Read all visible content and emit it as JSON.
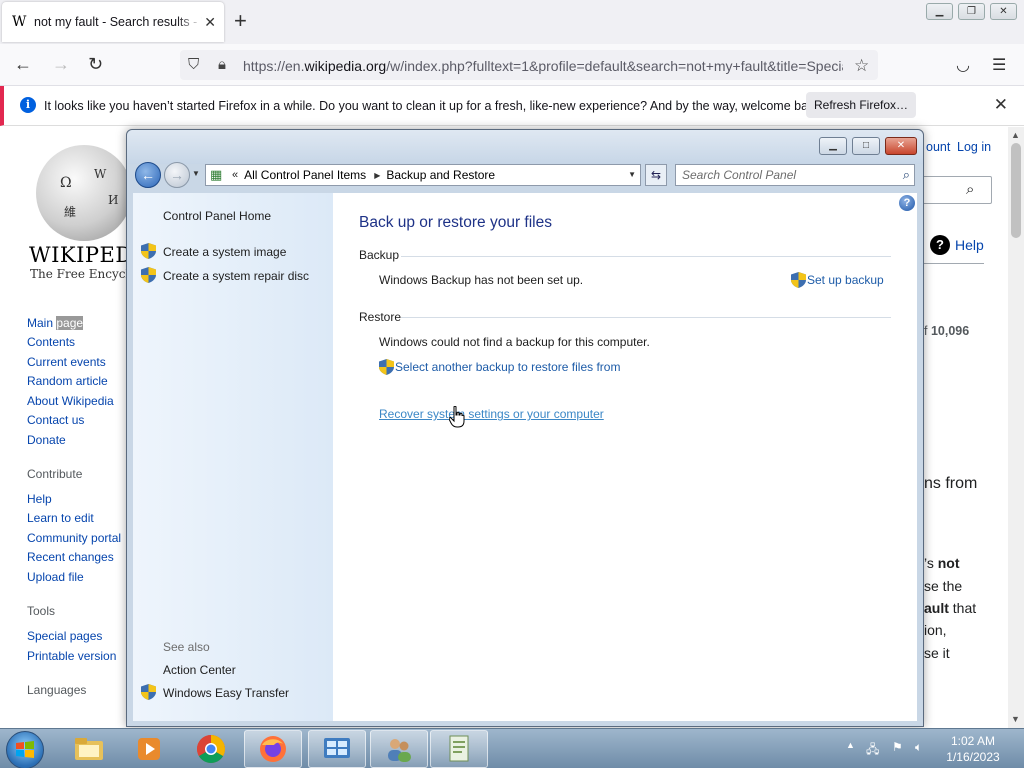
{
  "browser": {
    "tab_title": "not my fault - Search results - Wikipedia",
    "tab_favicon": "W",
    "new_tab": "+",
    "url_prefix": "https://en.",
    "url_domain": "wikipedia.org",
    "url_path": "/w/index.php?fulltext=1&profile=default&search=not+my+fault&title=Special:Search",
    "notice_text": "It looks like you haven’t started Firefox in a while. Do you want to clean it up for a fresh, like-new experience? And by the way, welcome back!",
    "notice_button": "Refresh Firefox…"
  },
  "wiki": {
    "wordmark": "WIKIPEDIA",
    "tagline": "The Free Encyclopedia",
    "account": "ount",
    "login": "Log in",
    "help": "Help",
    "nav_main": "Main",
    "nav_main_hl": "page",
    "nav": [
      "Contents",
      "Current events",
      "Random article",
      "About Wikipedia",
      "Contact us",
      "Donate"
    ],
    "contribute_heading": "Contribute",
    "contribute": [
      "Help",
      "Learn to edit",
      "Community portal",
      "Recent changes",
      "Upload file"
    ],
    "tools_heading": "Tools",
    "tools": [
      "Special pages",
      "Printable version"
    ],
    "languages_heading": "Languages",
    "results_count_prefix": "f ",
    "results_count": "10,096",
    "snippet_1": "ns from",
    "snippet_2a": "’s ",
    "snippet_2b": "not",
    "snippet_3": "se the",
    "snippet_4": "ault",
    "snippet_4b": " that",
    "snippet_5": "ion,",
    "snippet_6": "se it"
  },
  "control_panel": {
    "breadcrumb_1": "All Control Panel Items",
    "breadcrumb_2": "Backup and Restore",
    "search_placeholder": "Search Control Panel",
    "sidebar_home": "Control Panel Home",
    "sidebar_links": [
      "Create a system image",
      "Create a system repair disc"
    ],
    "see_also_heading": "See also",
    "see_also": [
      "Action Center",
      "Windows Easy Transfer"
    ],
    "title": "Back up or restore your files",
    "backup_heading": "Backup",
    "backup_status": "Windows Backup has not been set up.",
    "setup_backup": "Set up backup",
    "restore_heading": "Restore",
    "restore_status": "Windows could not find a backup for this computer.",
    "select_backup": "Select another backup to restore files from",
    "recover_link": "Recover system settings or your computer"
  },
  "taskbar": {
    "time": "1:02 AM",
    "date": "1/16/2023"
  },
  "colors": {
    "link_blue": "#0645ad",
    "cp_title_blue": "#1e3287",
    "firefox_accent": "#0060df"
  }
}
